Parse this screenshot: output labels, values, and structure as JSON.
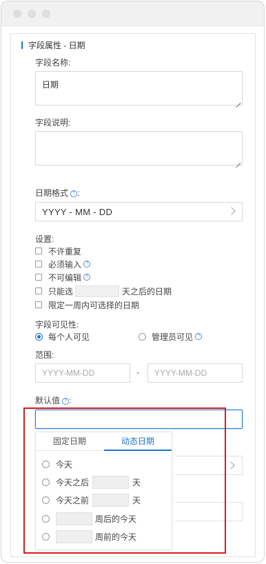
{
  "panel": {
    "title": "字段属性 - 日期",
    "field_name_label": "字段名称:",
    "field_name_value": "日期",
    "field_desc_label": "字段说明:",
    "date_format_label": "日期格式",
    "date_format_colon": ":",
    "date_format_value": "YYYY - MM - DD",
    "settings_label": "设置:",
    "settings": {
      "no_duplicate": "不许重复",
      "required": "必须输入",
      "not_editable": "不可编辑",
      "only_select": "只能选",
      "only_select_suffix": "天之后的日期",
      "within_week": "限定一周内可选择的日期"
    },
    "visibility_label": "字段可见性:",
    "visibility_everyone": "每个人可见",
    "visibility_admin": "管理员可见",
    "range_label": "范围:",
    "range_start_placeholder": "YYYY-MM-DD",
    "range_separator": "-",
    "range_end_placeholder": "YYYY-MM-DD",
    "default_label": "默认值",
    "default_colon": ":"
  },
  "dropdown": {
    "tab_fixed": "固定日期",
    "tab_dynamic": "动态日期",
    "active_tab": "动态日期",
    "options": {
      "today": "今天",
      "after_prefix": "今天之后",
      "after_suffix": "天",
      "before_prefix": "今天之前",
      "before_suffix": "天",
      "week_after_suffix": "周后的今天",
      "week_before_suffix": "周前的今天"
    }
  },
  "colors": {
    "accent": "#1a76d1",
    "highlight_frame": "#d9191b"
  }
}
